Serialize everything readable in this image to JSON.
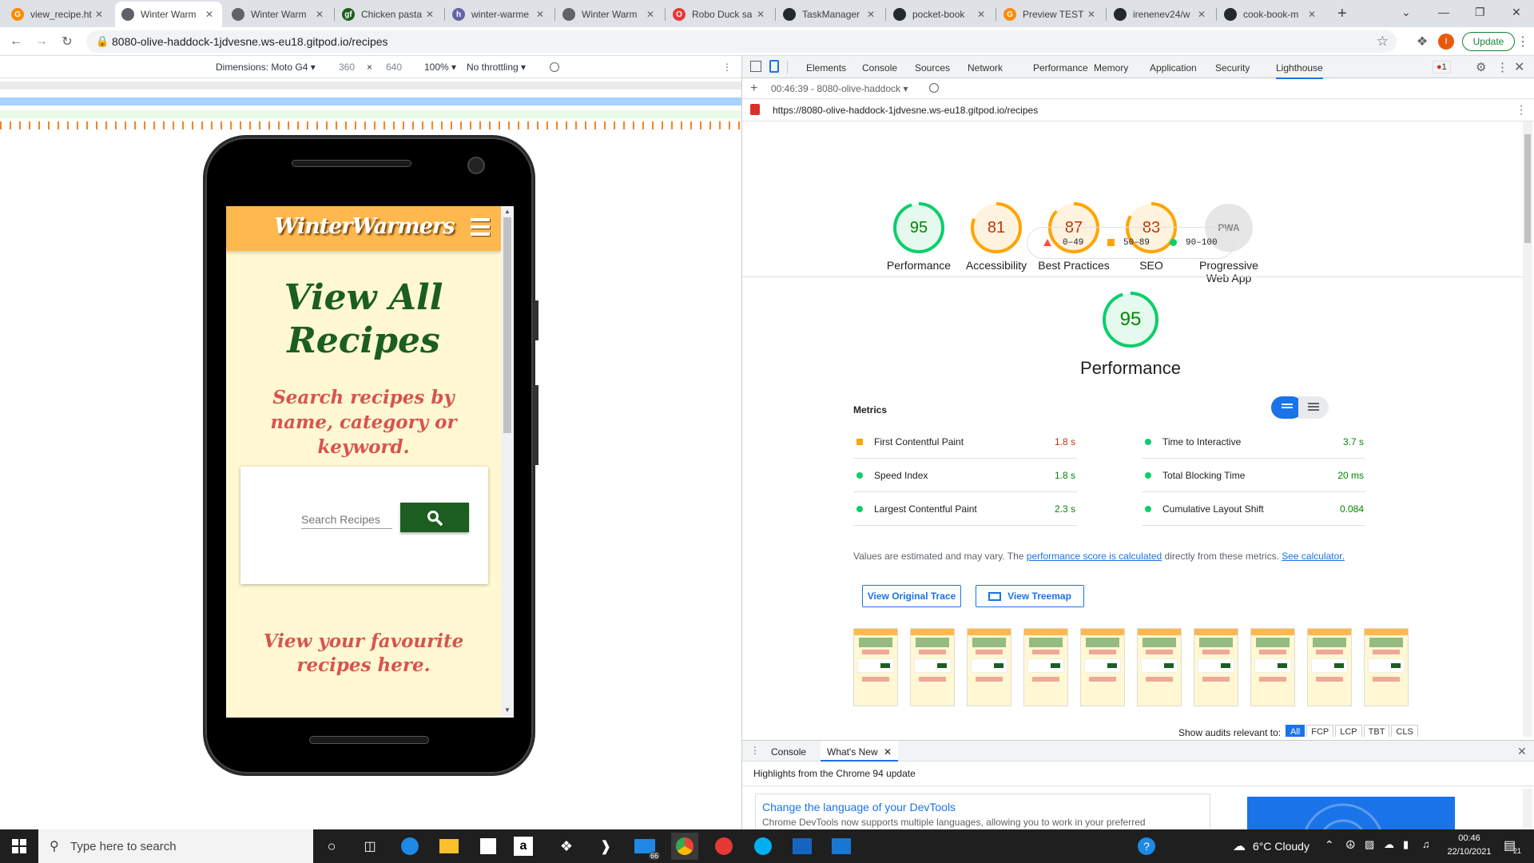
{
  "browser": {
    "tabs": [
      {
        "title": "view_recipe.ht",
        "favicon": "gitpod-icon",
        "color": "#ff8a00",
        "letter": "G"
      },
      {
        "title": "Winter Warm",
        "favicon": "globe-icon",
        "color": "#5f6368",
        "letter": ""
      },
      {
        "title": "Winter Warm",
        "favicon": "globe-icon",
        "color": "#5f6368",
        "letter": ""
      },
      {
        "title": "Chicken pasta",
        "favicon": "bbc-goodfood-icon",
        "color": "#1b5e20",
        "letter": "gf"
      },
      {
        "title": "winter-warme",
        "favicon": "heroku-icon",
        "color": "#6762a6",
        "letter": "h"
      },
      {
        "title": "Winter Warm",
        "favicon": "globe-icon",
        "color": "#5f6368",
        "letter": ""
      },
      {
        "title": "Robo Duck sa",
        "favicon": "robo-duck-icon",
        "color": "#e53935",
        "letter": "O"
      },
      {
        "title": "TaskManager",
        "favicon": "github-icon",
        "color": "#24292e",
        "letter": ""
      },
      {
        "title": "pocket-book",
        "favicon": "github-icon",
        "color": "#24292e",
        "letter": ""
      },
      {
        "title": "Preview TEST",
        "favicon": "gitpod-icon",
        "color": "#ff8a00",
        "letter": "G"
      },
      {
        "title": "irenenev24/w",
        "favicon": "github-icon",
        "color": "#24292e",
        "letter": ""
      },
      {
        "title": "cook-book-m",
        "favicon": "github-icon",
        "color": "#24292e",
        "letter": ""
      }
    ],
    "active_tab": 1,
    "url": "8080-olive-haddock-1jdvesne.ws-eu18.gitpod.io/recipes",
    "update_label": "Update",
    "profile_letter": "I"
  },
  "device_toolbar": {
    "dimensions": "Dimensions: Moto G4",
    "width": "360",
    "times": "×",
    "height": "640",
    "zoom": "100%",
    "throttle": "No throttling"
  },
  "site": {
    "brand": "WinterWarmers",
    "title": "View All Recipes",
    "subtitle": "Search recipes by name, category or keyword.",
    "search_placeholder": "Search Recipes",
    "favourites": "View your favourite recipes here.",
    "colors": {
      "nav": "#ffb84d",
      "bg": "#fff8d2",
      "title": "#1b5e20",
      "subtitle": "#d9534f",
      "button": "#1b5e20"
    }
  },
  "devtools": {
    "tabs": [
      "Elements",
      "Console",
      "Sources",
      "Network",
      "Performance",
      "Memory",
      "Application",
      "Security",
      "Lighthouse"
    ],
    "active_tab": "Lighthouse",
    "error_count": "1",
    "report_label": "00:46:39 - 8080-olive-haddock",
    "report_url": "https://8080-olive-haddock-1jdvesne.ws-eu18.gitpod.io/recipes",
    "scores": [
      {
        "label": "Performance",
        "value": 95,
        "color": "#0cce6b",
        "bg": "#e6f9ee",
        "text": "#008800"
      },
      {
        "label": "Accessibility",
        "value": 81,
        "color": "#ffa400",
        "bg": "#fff3e0",
        "text": "#c33300"
      },
      {
        "label": "Best Practices",
        "value": 87,
        "color": "#ffa400",
        "bg": "#fff3e0",
        "text": "#c33300"
      },
      {
        "label": "SEO",
        "value": 83,
        "color": "#ffa400",
        "bg": "#fff3e0",
        "text": "#c33300"
      },
      {
        "label": "Progressive Web App",
        "value": "PWA",
        "color": "#c7c7c7",
        "bg": "#e6e6e6",
        "text": "#888"
      }
    ],
    "legend": [
      {
        "range": "0–49",
        "color": "#ff4e42",
        "shape": "triangle"
      },
      {
        "range": "50–89",
        "color": "#ffa400",
        "shape": "square"
      },
      {
        "range": "90–100",
        "color": "#0cce6b",
        "shape": "circle"
      }
    ],
    "section_score": 95,
    "section_title": "Performance",
    "metrics_title": "Metrics",
    "metrics": [
      {
        "name": "First Contentful Paint",
        "value": "1.8 s",
        "status": "average"
      },
      {
        "name": "Time to Interactive",
        "value": "3.7 s",
        "status": "pass"
      },
      {
        "name": "Speed Index",
        "value": "1.8 s",
        "status": "pass"
      },
      {
        "name": "Total Blocking Time",
        "value": "20 ms",
        "status": "pass"
      },
      {
        "name": "Largest Contentful Paint",
        "value": "2.3 s",
        "status": "pass"
      },
      {
        "name": "Cumulative Layout Shift",
        "value": "0.084",
        "status": "pass"
      }
    ],
    "note_prefix": "Values are estimated and may vary. The ",
    "note_link1": "performance score is calculated",
    "note_mid": " directly from these metrics. ",
    "note_link2": "See calculator.",
    "view_trace": "View Original Trace",
    "view_treemap": "View Treemap",
    "audits_label": "Show audits relevant to:",
    "audit_filters": [
      "All",
      "FCP",
      "LCP",
      "TBT",
      "CLS"
    ],
    "drawer_tabs": [
      "Console",
      "What's New"
    ],
    "drawer_active": "What's New",
    "drawer_heading": "Highlights from the Chrome 94 update",
    "drawer_link": "Change the language of your DevTools",
    "drawer_text": "Chrome DevTools now supports multiple languages, allowing you to work in your preferred"
  },
  "taskbar": {
    "search_placeholder": "Type here to search",
    "weather": "6°C  Cloudy",
    "time": "00:46",
    "date": "22/10/2021",
    "mail_badge": "66",
    "notification_count": "21"
  }
}
